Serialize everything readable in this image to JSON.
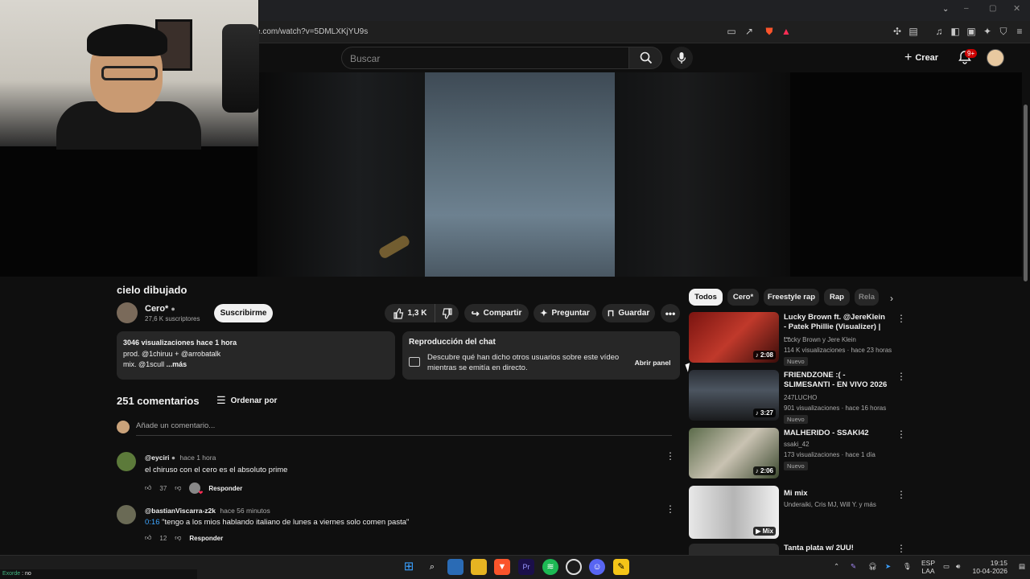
{
  "browser": {
    "url": "e.com/watch?v=5DMLXKjYU9s"
  },
  "header": {
    "search_placeholder": "Buscar",
    "create_label": "Crear",
    "notifications_badge": "9+"
  },
  "video": {
    "title": "cielo dibujado",
    "channel": {
      "name": "Cero*",
      "subscribers": "27,6 K suscriptores",
      "subscribe_label": "Suscribirme"
    },
    "actions": {
      "likes": "1,3 K",
      "share": "Compartir",
      "ask": "Preguntar",
      "save": "Guardar"
    },
    "description": {
      "stats": "3046 visualizaciones  hace 1 hora",
      "line1": "prod. @1chiruu + @arrobatalk",
      "line2": "mix. @1scull",
      "more": "...más"
    },
    "chat_replay": {
      "title": "Reproducción del chat",
      "text": "Descubre qué han dicho otros usuarios sobre este vídeo mientras se emitía en directo.",
      "button": "Abrir panel"
    }
  },
  "comments": {
    "count": "251 comentarios",
    "sort_label": "Ordenar por",
    "add_placeholder": "Añade un comentario...",
    "items": [
      {
        "author": "@eyciri",
        "time": "hace 1 hora",
        "timestamp": "",
        "text": "el chiruso con el cero es el absoluto prime",
        "likes": "37",
        "reply": "Responder"
      },
      {
        "author": "@bastianViscarra-z2k",
        "time": "hace 56 minutos",
        "timestamp": "0:16",
        "text": "\"tengo a los mios hablando italiano de lunes a viernes solo comen pasta\"",
        "likes": "12",
        "reply": "Responder"
      }
    ]
  },
  "sidebar": {
    "chips": [
      "Todos",
      "Cero*",
      "Freestyle rap",
      "Rap",
      "Rela"
    ],
    "recommendations": [
      {
        "title": "Lucky Brown ft. @JereKlein - Patek Phillie (Visualizer) | ...",
        "channel": "Lucky Brown  y Jere Klein",
        "meta": "114 K visualizaciones · hace 23 horas",
        "badge": "Nuevo",
        "duration": "2:08"
      },
      {
        "title": "FRIENDZONE :( - SLIMESANTI - EN VIVO 2026",
        "channel": "247LUCHO",
        "meta": "901 visualizaciones · hace 16 horas",
        "badge": "Nuevo",
        "duration": "3:27"
      },
      {
        "title": "MALHERIDO - SSAKI42",
        "channel": "ssaki_42",
        "meta": "173 visualizaciones · hace 1 día",
        "badge": "Nuevo",
        "duration": "2:06"
      },
      {
        "title": "Mi mix",
        "channel": "Underaiki, Cris MJ, Will Y. y más",
        "meta": "",
        "badge": "",
        "duration": "Mix"
      },
      {
        "title": "Tanta plata w/ 2UU!",
        "channel": "",
        "meta": "",
        "badge": "",
        "duration": ""
      }
    ]
  },
  "taskbar": {
    "lang_top": "ESP",
    "lang_bottom": "LAA",
    "time": "19:15",
    "date": "10-04-2026"
  },
  "status": {
    "app": "Exorde",
    "value": "no"
  }
}
